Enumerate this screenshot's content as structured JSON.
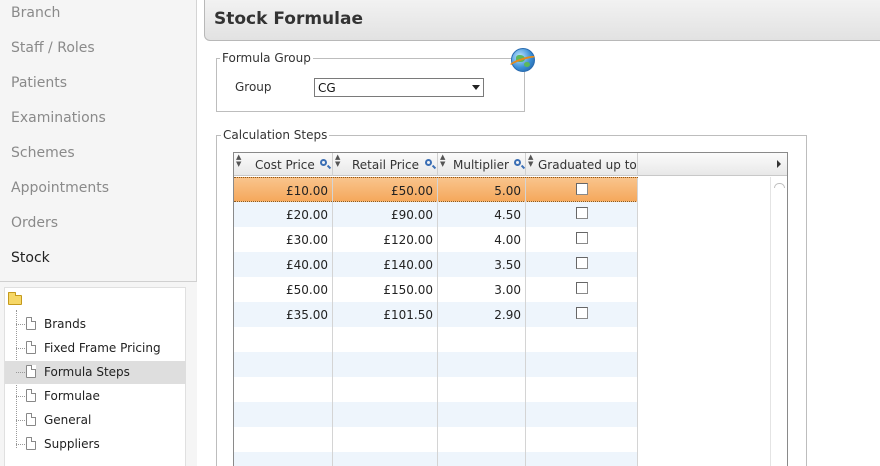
{
  "sidebar": {
    "items": [
      {
        "label": "Branch"
      },
      {
        "label": "Staff / Roles"
      },
      {
        "label": "Patients"
      },
      {
        "label": "Examinations"
      },
      {
        "label": "Schemes"
      },
      {
        "label": "Appointments"
      },
      {
        "label": "Orders"
      },
      {
        "label": "Stock"
      }
    ],
    "active": "Stock",
    "tree": [
      {
        "label": "Brands"
      },
      {
        "label": "Fixed Frame Pricing"
      },
      {
        "label": "Formula Steps"
      },
      {
        "label": "Formulae"
      },
      {
        "label": "General"
      },
      {
        "label": "Suppliers"
      }
    ],
    "tree_selected": "Formula Steps"
  },
  "header": {
    "title": "Stock Formulae"
  },
  "formula_group": {
    "legend": "Formula Group",
    "group_label": "Group",
    "group_value": "CG"
  },
  "calc_steps": {
    "legend": "Calculation Steps",
    "columns": [
      "Cost Price",
      "Retail Price",
      "Multiplier",
      "Graduated up to"
    ],
    "rows": [
      {
        "cost": "£10.00",
        "retail": "£50.00",
        "multiplier": "5.00",
        "graduated": false
      },
      {
        "cost": "£20.00",
        "retail": "£90.00",
        "multiplier": "4.50",
        "graduated": false
      },
      {
        "cost": "£30.00",
        "retail": "£120.00",
        "multiplier": "4.00",
        "graduated": false
      },
      {
        "cost": "£40.00",
        "retail": "£140.00",
        "multiplier": "3.50",
        "graduated": false
      },
      {
        "cost": "£50.00",
        "retail": "£150.00",
        "multiplier": "3.00",
        "graduated": false
      },
      {
        "cost": "£35.00",
        "retail": "£101.50",
        "multiplier": "2.90",
        "graduated": false
      }
    ],
    "selected_row": 0
  }
}
